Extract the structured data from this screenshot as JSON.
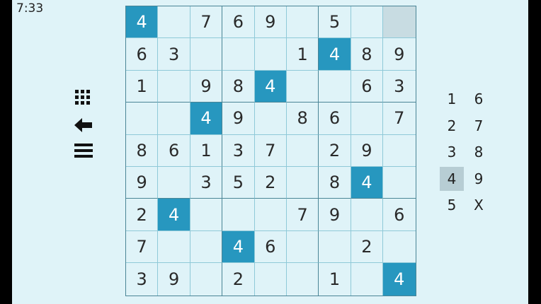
{
  "status_bar": {
    "time": "7:33"
  },
  "colors": {
    "background": "#dff3f8",
    "highlight": "#2797bf",
    "selected": "#c8dce2",
    "pad_selected": "#b7cdd4"
  },
  "toolbar": {
    "icons": [
      "grid-icon",
      "back-arrow-icon",
      "menu-icon"
    ]
  },
  "highlight_value": "4",
  "selected_cell": [
    0,
    8
  ],
  "board": [
    [
      "4",
      "",
      "7",
      "6",
      "9",
      "",
      "5",
      "",
      ""
    ],
    [
      "6",
      "3",
      "",
      "",
      "",
      "1",
      "4",
      "8",
      "9"
    ],
    [
      "1",
      "",
      "9",
      "8",
      "4",
      "",
      "",
      "6",
      "3"
    ],
    [
      "",
      "",
      "4",
      "9",
      "",
      "8",
      "6",
      "",
      "7"
    ],
    [
      "8",
      "6",
      "1",
      "3",
      "7",
      "",
      "2",
      "9",
      ""
    ],
    [
      "9",
      "",
      "3",
      "5",
      "2",
      "",
      "8",
      "4",
      ""
    ],
    [
      "2",
      "4",
      "",
      "",
      "",
      "7",
      "9",
      "",
      "6"
    ],
    [
      "7",
      "",
      "",
      "4",
      "6",
      "",
      "",
      "2",
      ""
    ],
    [
      "3",
      "9",
      "",
      "2",
      "",
      "",
      "1",
      "",
      "4"
    ]
  ],
  "number_pad": {
    "left": [
      "1",
      "2",
      "3",
      "4",
      "5"
    ],
    "right": [
      "6",
      "7",
      "8",
      "9",
      "X"
    ],
    "selected": "4"
  }
}
